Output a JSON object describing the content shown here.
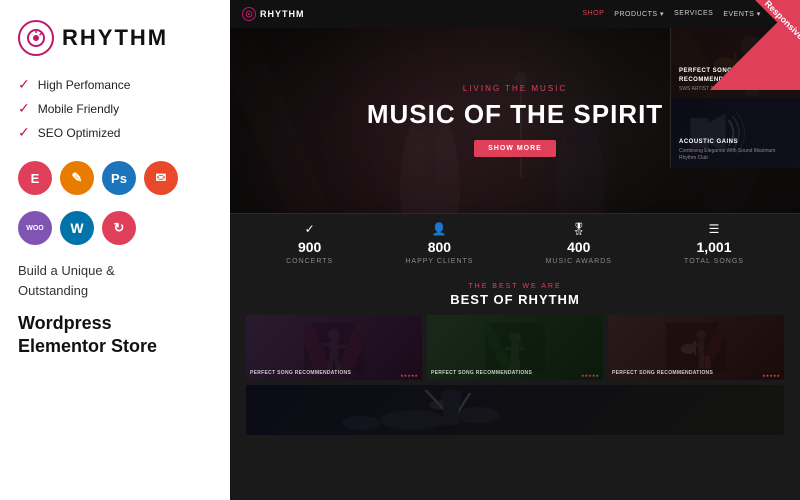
{
  "left": {
    "logo_text": "RHYTHM",
    "features": [
      {
        "text": "High Perfomance"
      },
      {
        "text": "Mobile Friendly"
      },
      {
        "text": "SEO Optimized"
      }
    ],
    "tech_icons_row1": [
      {
        "label": "E",
        "class": "elementor",
        "name": "elementor"
      },
      {
        "label": "✎",
        "class": "edit",
        "name": "edit"
      },
      {
        "label": "Ps",
        "class": "ps",
        "name": "photoshop"
      },
      {
        "label": "✉",
        "class": "mail",
        "name": "mailchimp"
      }
    ],
    "tech_icons_row2": [
      {
        "label": "Woo",
        "class": "woo",
        "name": "woocommerce"
      },
      {
        "label": "W",
        "class": "wp",
        "name": "wordpress"
      },
      {
        "label": "↻",
        "class": "refresh",
        "name": "refresh"
      }
    ],
    "build_text": "Build a Unique &\nOutstanding",
    "wordpress_text": "Wordpress\nElementor Store"
  },
  "nav": {
    "logo": "RHYTHM",
    "links": [
      "SHOP",
      "PRODUCTS",
      "SERVICES",
      "EVENTS"
    ]
  },
  "hero": {
    "subtitle": "LIVING THE MUSIC",
    "title": "MUSIC OF THE SPIRIT",
    "button": "SHOW MORE"
  },
  "stats": [
    {
      "icon": "✓",
      "number": "900",
      "label": "Concerts"
    },
    {
      "icon": "👤",
      "number": "800",
      "label": "Happy Clients"
    },
    {
      "icon": "🎖",
      "number": "400",
      "label": "Music Awards"
    },
    {
      "icon": "≡",
      "number": "1,001",
      "label": "Total Songs"
    }
  ],
  "best_section": {
    "tag": "THE BEST WE ARE",
    "title": "BEST OF RHYTHM",
    "thumbs": [
      {
        "class": "dark1",
        "label": "PERFECT SONG RECOMMENDATIONS",
        "sub": "★★★★★"
      },
      {
        "class": "dark2",
        "label": "PERFECT SONG RECOMMENDATIONS",
        "sub": "★★★★★"
      },
      {
        "class": "dark3",
        "label": "PERFECT SONG RECOMMENDATIONS",
        "sub": "★★★★★"
      }
    ]
  },
  "side_cards": [
    {
      "class": "guitar",
      "label": "PERFECT SONG RECOMMENDATIONS",
      "sub": "SWS ARTIST TOOLS"
    },
    {
      "class": "speaker",
      "label": "ACOUSTIC GAINS",
      "sub": "Combining Elegance With Sound\nMaximum Rhythm Club"
    }
  ],
  "responsive_badge": "Responsive"
}
